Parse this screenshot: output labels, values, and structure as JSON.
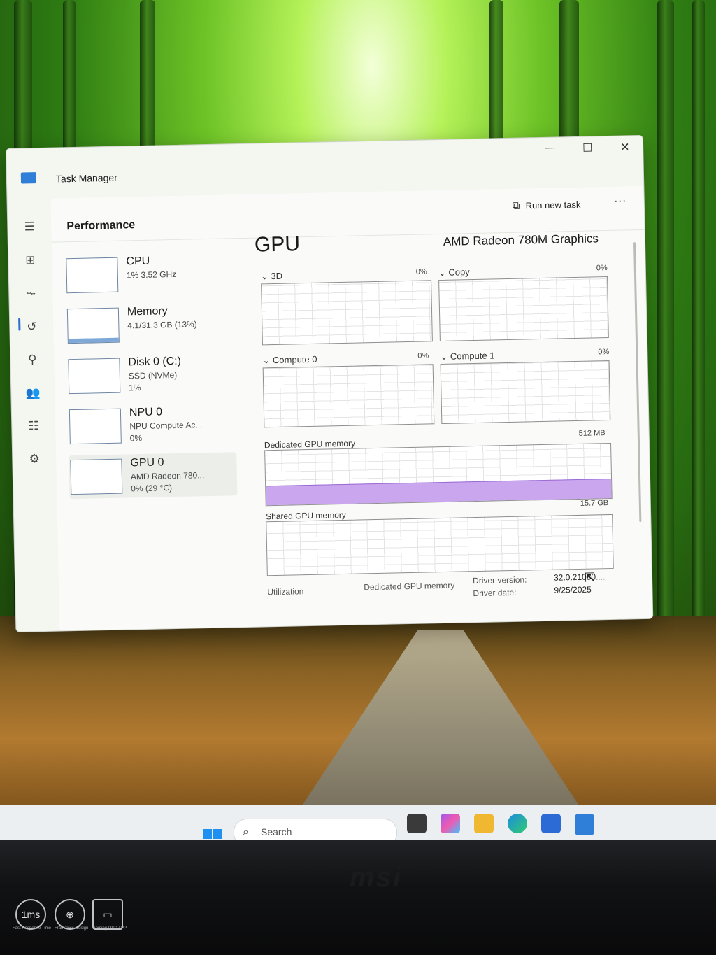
{
  "window": {
    "title": "Task Manager",
    "minimize_glyph": "—",
    "maximize_glyph": "☐",
    "close_glyph": "✕"
  },
  "nav_icons": [
    "hamburger-icon",
    "processes-icon",
    "performance-icon",
    "app-history-icon",
    "startup-apps-icon",
    "users-icon",
    "details-icon",
    "services-icon"
  ],
  "header": {
    "page_title": "Performance",
    "run_new_task": "Run new task",
    "more": "···"
  },
  "sidebar": {
    "items": [
      {
        "name": "CPU",
        "line1": "1%  3.52 GHz",
        "line2": ""
      },
      {
        "name": "Memory",
        "line1": "4.1/31.3 GB (13%)",
        "line2": ""
      },
      {
        "name": "Disk 0 (C:)",
        "line1": "SSD (NVMe)",
        "line2": "1%"
      },
      {
        "name": "NPU 0",
        "line1": "NPU Compute Ac...",
        "line2": "0%"
      },
      {
        "name": "GPU 0",
        "line1": "AMD Radeon 780...",
        "line2": "0%  (29 °C)"
      }
    ]
  },
  "main": {
    "title": "GPU",
    "model": "AMD Radeon 780M Graphics",
    "engines": [
      {
        "label": "3D",
        "pct": "0%"
      },
      {
        "label": "Copy",
        "pct": "0%"
      },
      {
        "label": "Compute 0",
        "pct": "0%"
      },
      {
        "label": "Compute 1",
        "pct": "0%"
      }
    ],
    "dedicated_label": "Dedicated GPU memory",
    "dedicated_max": "512 MB",
    "dedicated_fill": 0.34,
    "shared_label": "Shared GPU memory",
    "shared_max": "15.7 GB",
    "stats": {
      "utilization_label": "Utilization",
      "dedicated_label": "Dedicated GPU memory",
      "driver_version_label": "Driver version:",
      "driver_version_value": "32.0.21030....",
      "driver_date_label": "Driver date:",
      "driver_date_value": "9/25/2025"
    }
  },
  "taskbar": {
    "search_placeholder": "Search"
  },
  "monitor": {
    "brand": "msi",
    "bezel_labels": [
      "1ms",
      "Fast Response Time",
      "Frameless Design",
      "Gaming OSD APP"
    ]
  }
}
